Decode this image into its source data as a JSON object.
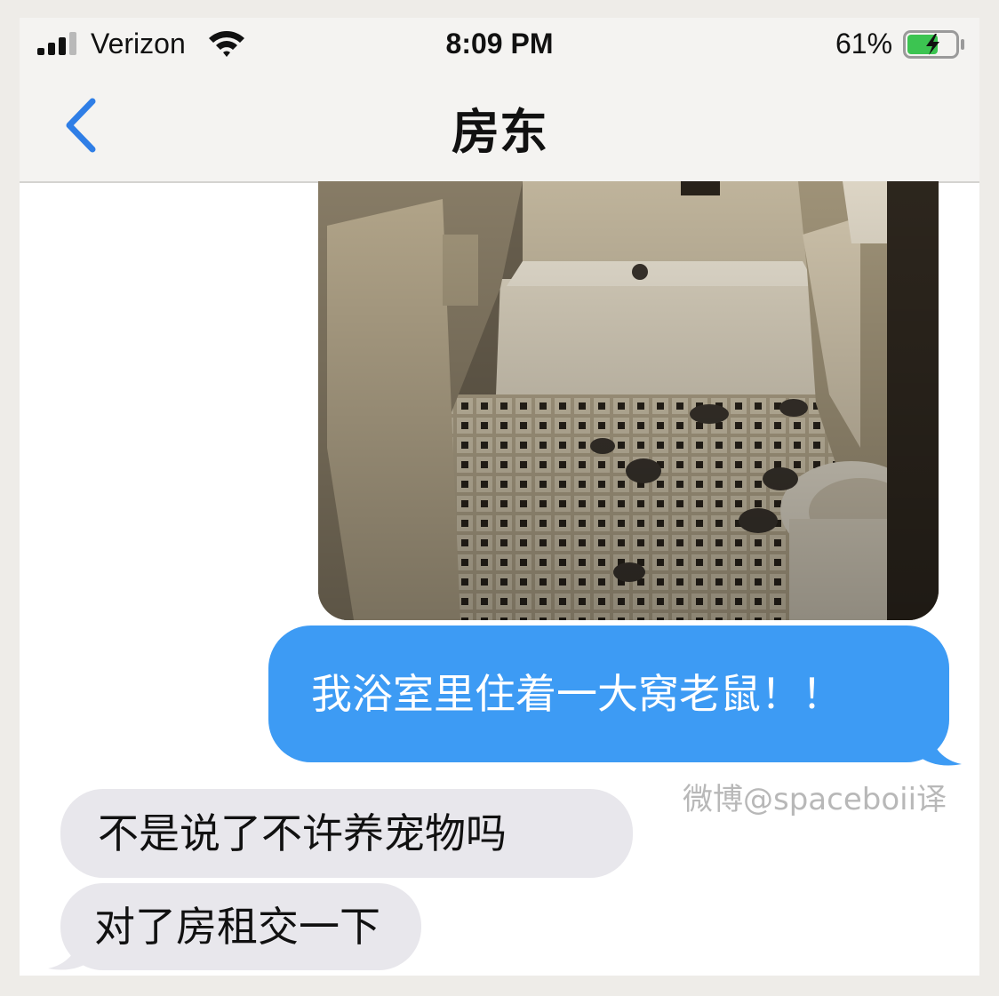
{
  "status_bar": {
    "carrier": "Verizon",
    "time": "8:09 PM",
    "battery_percent": "61%",
    "signal_bars": 3,
    "signal_bars_total": 4
  },
  "conversation": {
    "contact_name": "房东",
    "back_icon": "chevron-left-icon"
  },
  "messages": [
    {
      "direction": "outgoing",
      "type": "image",
      "description_icon": "photo-attachment"
    },
    {
      "direction": "outgoing",
      "type": "text",
      "text": "我浴室里住着一大窝老鼠！！"
    },
    {
      "direction": "incoming",
      "type": "text",
      "text": "不是说了不许养宠物吗"
    },
    {
      "direction": "incoming",
      "type": "text",
      "text": "对了房租交一下"
    }
  ],
  "watermark": "微博@spaceboii译",
  "colors": {
    "outgoing_bubble": "#3d9bf4",
    "incoming_bubble": "#e8e7ec",
    "accent": "#2f7ee6",
    "battery_fill": "#3cc451"
  }
}
